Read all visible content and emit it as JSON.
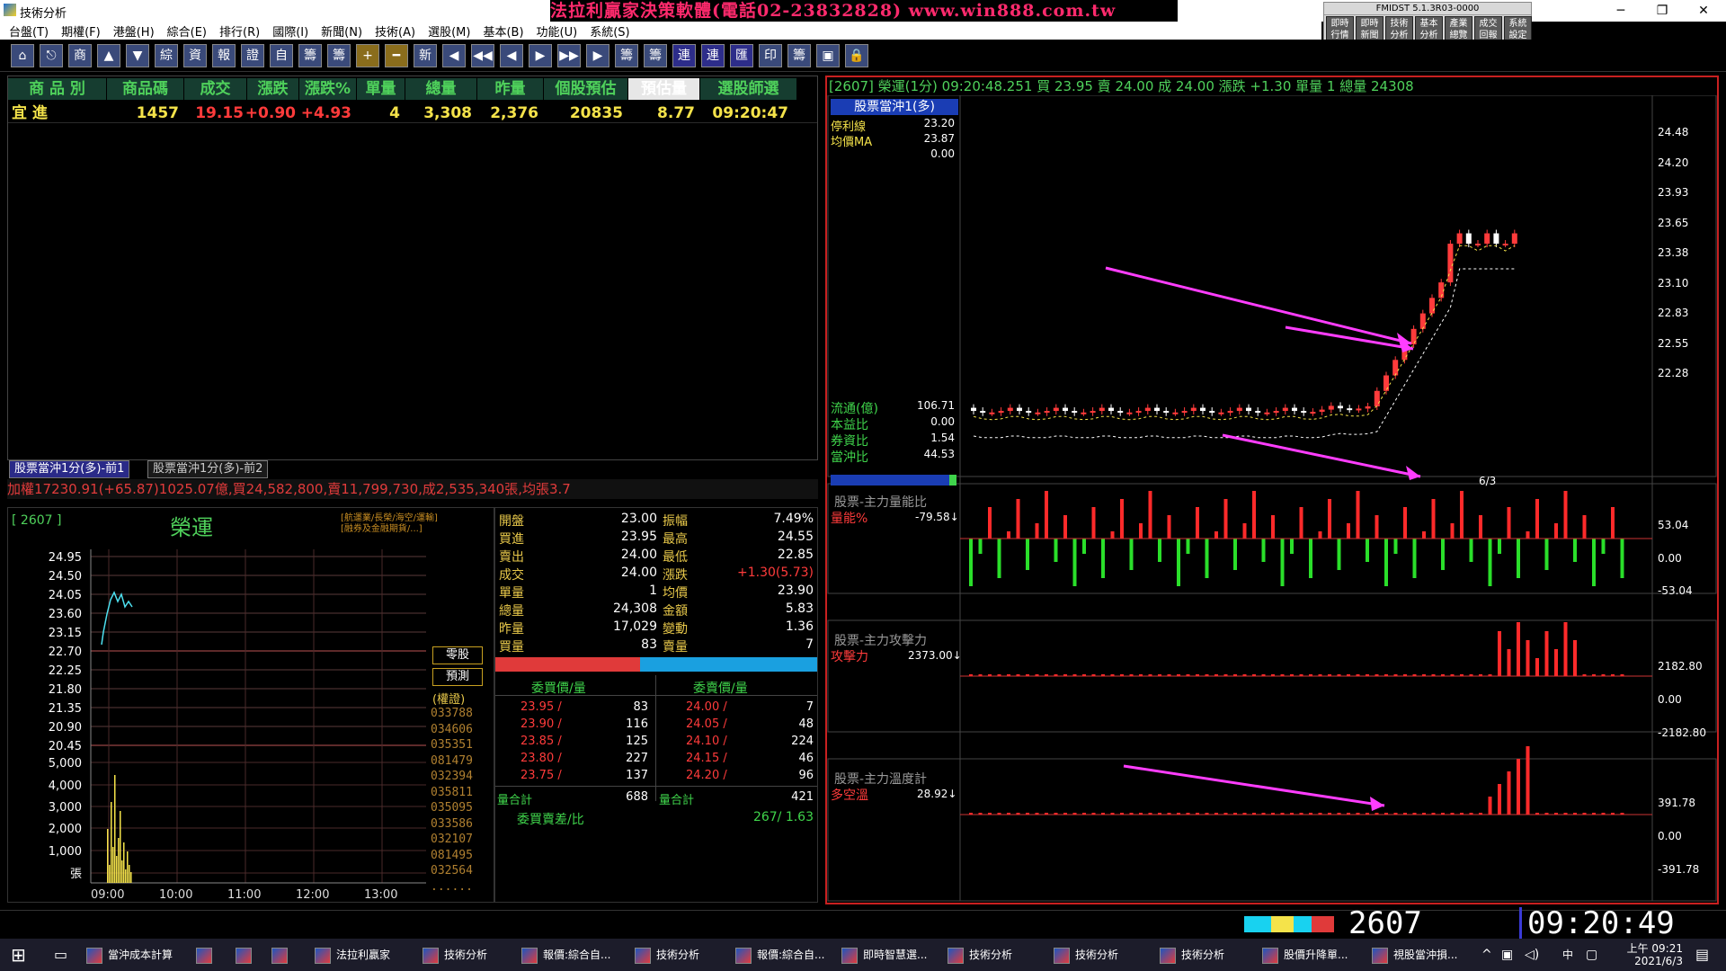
{
  "window": {
    "title": "技術分析",
    "banner": "法拉利贏家決策軟體(電話02-23832828) www.win888.com.tw",
    "minimize": "─",
    "restore": "❐",
    "close": "✕"
  },
  "fmdist": {
    "title": "FMIDST 5.1.3R03-0000",
    "buttons": [
      "即時\n行情",
      "即時\n新聞",
      "技術\n分析",
      "基本\n分析",
      "產業\n總覽",
      "成交\n回報",
      "系統\n設定"
    ]
  },
  "menu": [
    "台盤(T)",
    "期權(F)",
    "港盤(H)",
    "綜合(E)",
    "排行(R)",
    "國際(I)",
    "新聞(N)",
    "技術(A)",
    "選股(M)",
    "基本(B)",
    "功能(U)",
    "系統(S)"
  ],
  "toolbar": [
    "⌂",
    "⎋",
    "商",
    "▲",
    "▼",
    "綜",
    "資",
    "報",
    "證",
    "自",
    "籌",
    "籌",
    "+",
    "━",
    "新",
    "◀",
    "◀◀",
    "◀",
    "▶",
    "▶▶",
    "▶",
    "籌",
    "籌",
    "連",
    "連",
    "匯",
    "印",
    "籌",
    "▣",
    "🔒"
  ],
  "quote": {
    "headers": [
      "商 品 別",
      "商品碼",
      "成交",
      "漲跌",
      "漲跌%",
      "單量",
      "總量",
      "昨量",
      "個股預估",
      "預估量",
      "選股師選"
    ],
    "row": {
      "name": "宜 進",
      "code": "1457",
      "price": "19.15",
      "change": "+0.90",
      "pct": "+4.93",
      "vol": "4",
      "total": "3,308",
      "yvol": "2,376",
      "est": "20835",
      "estv": "8.77",
      "time": "09:20:47"
    }
  },
  "tabs": [
    "股票當沖1分(多)-前1",
    "股票當沖1分(多)-前2"
  ],
  "ticker": "加權17230.91(+65.87)1025.07億,買24,582,800,賣11,799,730,成2,535,340張,均張3.7",
  "intraday": {
    "code": "[ 2607 ]",
    "name": "榮運",
    "note1": "[航運業/長榮/海空/運輸]",
    "note2": "[融券及金融期貨/...]",
    "price_ticks": [
      "24.95",
      "24.50",
      "24.05",
      "23.60",
      "23.15",
      "22.70",
      "22.25",
      "21.80",
      "21.35",
      "20.90",
      "20.45"
    ],
    "vol_ticks": [
      "5,000",
      "4,000",
      "3,000",
      "2,000",
      "1,000",
      "張"
    ],
    "time_ticks": [
      "09:00",
      "10:00",
      "11:00",
      "12:00",
      "13:00"
    ],
    "btn1": "零股",
    "btn2": "預測",
    "warrant": "(權證)",
    "codes": [
      "033788",
      "034606",
      "035351",
      "081479",
      "032394",
      "035811",
      "035095",
      "033586",
      "032107",
      "081495",
      "032564",
      "......"
    ]
  },
  "detail": {
    "left": [
      [
        "開盤",
        "23.00"
      ],
      [
        "買進",
        "23.95"
      ],
      [
        "賣出",
        "24.00"
      ],
      [
        "成交",
        "24.00"
      ],
      [
        "單量",
        "1"
      ],
      [
        "總量",
        "24,308"
      ],
      [
        "昨量",
        "17,029"
      ],
      [
        "買量",
        "83"
      ]
    ],
    "right": [
      [
        "振幅",
        "7.49%"
      ],
      [
        "最高",
        "24.55"
      ],
      [
        "最低",
        "22.85"
      ],
      [
        "漲跌",
        "+1.30(5.73)"
      ],
      [
        "均價",
        "23.90"
      ],
      [
        "金額",
        "5.83"
      ],
      [
        "變動",
        "1.36"
      ],
      [
        "賣量",
        "7"
      ]
    ],
    "bid_head": "委買價/量",
    "ask_head": "委賣價/量",
    "bids": [
      [
        "23.95 /",
        "83"
      ],
      [
        "23.90 /",
        "116"
      ],
      [
        "23.85 /",
        "125"
      ],
      [
        "23.80 /",
        "227"
      ],
      [
        "23.75 /",
        "137"
      ]
    ],
    "asks": [
      [
        "24.00 /",
        "7"
      ],
      [
        "24.05 /",
        "48"
      ],
      [
        "24.10 /",
        "224"
      ],
      [
        "24.15 /",
        "46"
      ],
      [
        "24.20 /",
        "96"
      ]
    ],
    "bid_total_label": "量合計",
    "bid_total": "688",
    "ask_total_label": "量合計",
    "ask_total": "421",
    "ratio_label": "委買賣差/比",
    "ratio": "267/ 1.63"
  },
  "chart": {
    "info": "[2607] 榮運(1分)  09:20:48.251  買 23.95  賣 24.00  成 24.00  漲跌 +1.30  單量 1  總量 24308",
    "legend_title": "股票當沖1(多)",
    "legend": [
      [
        "停利線",
        "23.20"
      ],
      [
        "均價MA",
        "23.87"
      ],
      [
        "",
        "0.00"
      ]
    ],
    "side": [
      [
        "流通(億)",
        "106.71"
      ],
      [
        "本益比",
        "0.00"
      ],
      [
        "券資比",
        "1.54"
      ],
      [
        "當沖比",
        "44.53"
      ]
    ],
    "yticks": [
      "24.48",
      "24.20",
      "23.93",
      "23.65",
      "23.38",
      "23.10",
      "22.83",
      "22.55",
      "22.28"
    ],
    "date": "6/3",
    "sub1": {
      "title": "股票-主力量能比",
      "label": "量能%",
      "value": "-79.58↓",
      "ticks": [
        "53.04",
        "0.00",
        "-53.04"
      ]
    },
    "sub2": {
      "title": "股票-主力攻擊力",
      "label": "攻擊力",
      "value": "2373.00↓",
      "ticks": [
        "2182.80",
        "0.00",
        "-2182.80"
      ]
    },
    "sub3": {
      "title": "股票-主力溫度計",
      "label": "多空溫",
      "value": "28.92↓",
      "ticks": [
        "391.78",
        "0.00",
        "-391.78"
      ]
    }
  },
  "status": {
    "code": "2607",
    "time": "09:20:49"
  },
  "taskbar": {
    "items": [
      "當沖成本計算",
      "",
      "",
      "",
      "法拉利贏家",
      "技術分析",
      "報價:綜合自...",
      "技術分析",
      "報價:綜合自...",
      "即時智慧選...",
      "技術分析",
      "技術分析",
      "技術分析",
      "股價升降單...",
      "視股當沖損..."
    ],
    "clock": "上午 09:21",
    "date": "2021/6/3",
    "ime": "中"
  }
}
